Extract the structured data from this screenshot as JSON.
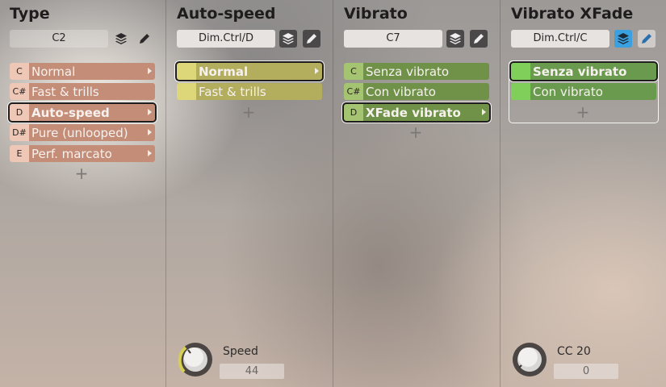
{
  "columns": {
    "type": {
      "title": "Type",
      "key": "C2",
      "items": [
        {
          "tag": "C",
          "label": "Normal"
        },
        {
          "tag": "C#",
          "label": "Fast & trills"
        },
        {
          "tag": "D",
          "label": "Auto-speed",
          "selected": true
        },
        {
          "tag": "D#",
          "label": "Pure (unlooped)"
        },
        {
          "tag": "E",
          "label": "Perf. marcato"
        }
      ],
      "add": "+"
    },
    "autospeed": {
      "title": "Auto-speed",
      "key": "Dim.Ctrl/D",
      "items": [
        {
          "tag": "",
          "label": "Normal",
          "selected": true
        },
        {
          "tag": "",
          "label": "Fast & trills"
        }
      ],
      "add": "+",
      "param": {
        "label": "Speed",
        "value": "44"
      }
    },
    "vibrato": {
      "title": "Vibrato",
      "key": "C7",
      "items": [
        {
          "tag": "C",
          "label": "Senza vibrato"
        },
        {
          "tag": "C#",
          "label": "Con vibrato"
        },
        {
          "tag": "D",
          "label": "XFade vibrato",
          "selected": true
        }
      ],
      "add": "+"
    },
    "xfade": {
      "title": "Vibrato XFade",
      "key": "Dim.Ctrl/C",
      "items": [
        {
          "tag": "",
          "label": "Senza vibrato",
          "selected": true
        },
        {
          "tag": "",
          "label": "Con vibrato"
        }
      ],
      "add": "+",
      "param": {
        "label": "CC 20",
        "value": "0"
      }
    }
  },
  "icons": {
    "layers": "layers-icon",
    "edit": "pencil-icon",
    "arrow": "play-arrow-icon",
    "knob": "knob-icon"
  },
  "colors": {
    "type_row": "#c48d78",
    "autospeed_row": "#b3ad5e",
    "vibrato_row": "#6f9248",
    "xfade_row": "#6a9a4d",
    "active_layer_button": "#3aa0e0",
    "knob_accent": "#d6cf55"
  }
}
